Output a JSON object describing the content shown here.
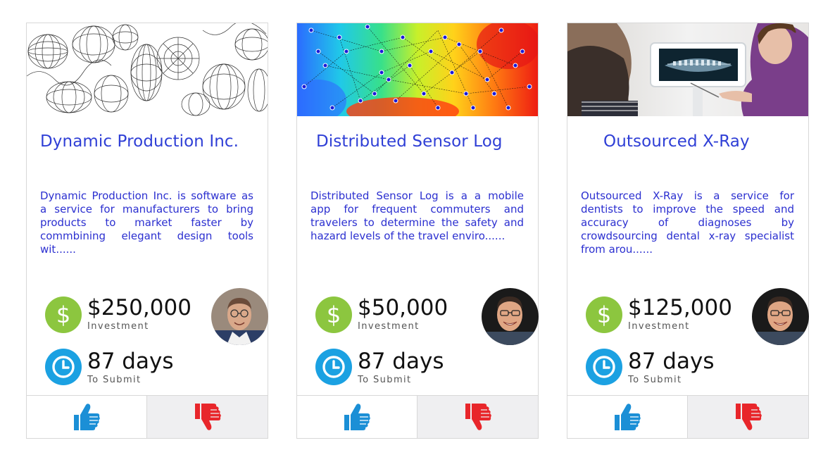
{
  "cards": [
    {
      "title": "Dynamic Production Inc.",
      "description": "Dynamic Production Inc. is software as a service for manufacturers to bring products to market faster by commbining elegant design tools wit......",
      "investment": "$250,000",
      "investment_label": "Investment",
      "days": "87 days",
      "days_label": "To Submit",
      "image_icon": "wireframe-mesh-image",
      "avatar_icon": "founder-avatar"
    },
    {
      "title": "Distributed Sensor Log",
      "description": "Distributed Sensor Log is a a mobile app for frequent commuters and travelers to determine the safety and hazard levels of the travel enviro......",
      "investment": "$50,000",
      "investment_label": "Investment",
      "days": "87 days",
      "days_label": "To Submit",
      "image_icon": "sensor-network-heatmap-image",
      "avatar_icon": "founder-avatar"
    },
    {
      "title": "Outsourced X-Ray",
      "description": "Outsourced X-Ray is a service for dentists to improve the speed and accuracy of diagnoses by crowdsourcing dental x-ray specialist from arou......",
      "investment": "$125,000",
      "investment_label": "Investment",
      "days": "87 days",
      "days_label": "To Submit",
      "image_icon": "dental-xray-photo",
      "avatar_icon": "founder-avatar"
    }
  ],
  "icons": {
    "dollar": "$",
    "thumbs_up": "thumbs-up-icon",
    "thumbs_down": "thumbs-down-icon",
    "clock": "clock-icon"
  },
  "colors": {
    "title": "#2f3fd6",
    "description": "#2b2fd0",
    "dollar_green": "#8cc63f",
    "clock_blue": "#1ba1e2",
    "thumb_up_blue": "#1b8fd6",
    "thumb_down_red": "#e8262b"
  }
}
